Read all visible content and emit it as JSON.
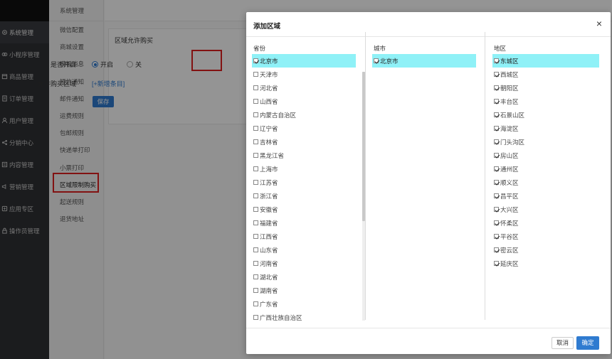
{
  "sidebar": {
    "items": [
      {
        "label": "系统管理",
        "icon": "gear-icon",
        "active": true
      },
      {
        "label": "小程序管理",
        "icon": "miniapp-icon"
      },
      {
        "label": "商品管理",
        "icon": "goods-icon"
      },
      {
        "label": "订单管理",
        "icon": "order-icon"
      },
      {
        "label": "用户管理",
        "icon": "user-icon"
      },
      {
        "label": "分销中心",
        "icon": "share-icon"
      },
      {
        "label": "内容管理",
        "icon": "content-icon"
      },
      {
        "label": "营销管理",
        "icon": "marketing-icon"
      },
      {
        "label": "应用专区",
        "icon": "app-icon"
      },
      {
        "label": "操作员管理",
        "icon": "operator-icon"
      }
    ]
  },
  "submenu": {
    "title": "系统管理",
    "items": [
      "微信配置",
      "商城设置",
      "模板消息",
      "短信通知",
      "邮件通知",
      "运费规则",
      "包邮规则",
      "快递单打印",
      "小票打印",
      "区域限制购买",
      "起送规则",
      "退货地址"
    ]
  },
  "main": {
    "section_title": "区域允许购买",
    "open_label": "是否开启",
    "open_option_on": "开启",
    "open_option_off": "关",
    "area_label": "允许购买区域",
    "add_link": "[+新增条目]",
    "save_label": "保存"
  },
  "modal": {
    "title": "添加区域",
    "close": "×",
    "province_header": "省份",
    "city_header": "城市",
    "district_header": "地区",
    "provinces": [
      {
        "name": "北京市",
        "checked": true,
        "selected": true
      },
      {
        "name": "天津市",
        "checked": false
      },
      {
        "name": "河北省",
        "checked": false
      },
      {
        "name": "山西省",
        "checked": false
      },
      {
        "name": "内蒙古自治区",
        "checked": false
      },
      {
        "name": "辽宁省",
        "checked": false
      },
      {
        "name": "吉林省",
        "checked": false
      },
      {
        "name": "黑龙江省",
        "checked": false
      },
      {
        "name": "上海市",
        "checked": false
      },
      {
        "name": "江苏省",
        "checked": false
      },
      {
        "name": "浙江省",
        "checked": false
      },
      {
        "name": "安徽省",
        "checked": false
      },
      {
        "name": "福建省",
        "checked": false
      },
      {
        "name": "江西省",
        "checked": false
      },
      {
        "name": "山东省",
        "checked": false
      },
      {
        "name": "河南省",
        "checked": false
      },
      {
        "name": "湖北省",
        "checked": false
      },
      {
        "name": "湖南省",
        "checked": false
      },
      {
        "name": "广东省",
        "checked": false
      },
      {
        "name": "广西壮族自治区",
        "checked": false
      }
    ],
    "cities": [
      {
        "name": "北京市",
        "checked": true,
        "selected": true
      }
    ],
    "districts": [
      {
        "name": "东城区",
        "checked": true,
        "selected": true
      },
      {
        "name": "西城区",
        "checked": true
      },
      {
        "name": "朝阳区",
        "checked": true
      },
      {
        "name": "丰台区",
        "checked": true
      },
      {
        "name": "石景山区",
        "checked": true
      },
      {
        "name": "海淀区",
        "checked": true
      },
      {
        "name": "门头沟区",
        "checked": true
      },
      {
        "name": "房山区",
        "checked": true
      },
      {
        "name": "通州区",
        "checked": true
      },
      {
        "name": "顺义区",
        "checked": true
      },
      {
        "name": "昌平区",
        "checked": true
      },
      {
        "name": "大兴区",
        "checked": true
      },
      {
        "name": "怀柔区",
        "checked": true
      },
      {
        "name": "平谷区",
        "checked": true
      },
      {
        "name": "密云区",
        "checked": true
      },
      {
        "name": "延庆区",
        "checked": true
      }
    ],
    "cancel_label": "取消",
    "confirm_label": "确定"
  },
  "colors": {
    "accent": "#2f7bd0",
    "highlight": "#8ff1f7",
    "annotation_red": "#e02020",
    "sidebar_bg": "#2f3135"
  }
}
